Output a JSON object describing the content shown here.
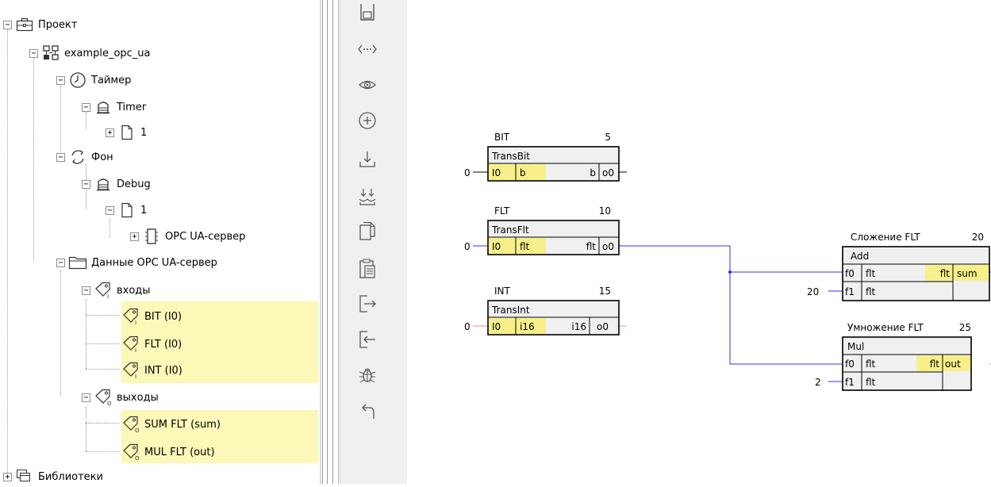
{
  "tree": {
    "items": [
      {
        "label": "Проект",
        "icon": "briefcase-icon"
      },
      {
        "label": "example_opc_ua",
        "icon": "structure-icon"
      },
      {
        "label": "Таймер",
        "icon": "clock-icon"
      },
      {
        "label": "Timer",
        "icon": "task-icon"
      },
      {
        "label": "1",
        "icon": "page-icon"
      },
      {
        "label": "Фон",
        "icon": "cycle-icon"
      },
      {
        "label": "Debug",
        "icon": "task-icon"
      },
      {
        "label": "1",
        "icon": "page-icon"
      },
      {
        "label": "OPC UA-сервер",
        "icon": "chip-icon"
      },
      {
        "label": "Данные OPC UA-сервер",
        "icon": "folder-icon"
      },
      {
        "label": "входы",
        "icon": "tag-icon",
        "sub": "I"
      },
      {
        "label": "BIT  (I0)",
        "icon": "tag-icon",
        "sub": "I"
      },
      {
        "label": "FLT  (I0)",
        "icon": "tag-icon",
        "sub": "I"
      },
      {
        "label": "INT  (I0)",
        "icon": "tag-icon",
        "sub": "I"
      },
      {
        "label": "выходы",
        "icon": "tag-icon",
        "sub": "O"
      },
      {
        "label": "SUM FLT  (sum)",
        "icon": "tag-icon",
        "sub": "O"
      },
      {
        "label": "MUL FLT  (out)",
        "icon": "tag-icon",
        "sub": "O"
      },
      {
        "label": "Библиотеки",
        "icon": "library-icon"
      }
    ]
  },
  "toolbar": {
    "buttons": [
      "save-icon",
      "connect-icon",
      "view-icon",
      "add-icon",
      "download-icon",
      "import-icon",
      "copy-icon",
      "paste-icon",
      "export-icon",
      "login-icon",
      "debug-icon",
      "undo-icon"
    ]
  },
  "blocks": {
    "bit": {
      "name": "BIT",
      "num": "5",
      "type": "TransBit",
      "in": "I0",
      "intype": "b",
      "outtype": "b",
      "out": "o0",
      "const": "0"
    },
    "flt": {
      "name": "FLT",
      "num": "10",
      "type": "TransFlt",
      "in": "I0",
      "intype": "flt",
      "outtype": "flt",
      "out": "o0",
      "const": "0"
    },
    "int": {
      "name": "INT",
      "num": "15",
      "type": "TransInt",
      "in": "I0",
      "intype": "i16",
      "outtype": "i16",
      "out": "o0",
      "const": "0"
    },
    "add": {
      "name": "Сложение FLT",
      "num": "20",
      "type": "Add",
      "in0": "f0",
      "in0type": "flt",
      "in1": "f1",
      "in1type": "flt",
      "outtype": "flt",
      "out": "sum",
      "const1": "20"
    },
    "mul": {
      "name": "Умножение FLT",
      "num": "25",
      "type": "Mul",
      "in0": "f0",
      "in0type": "flt",
      "in1": "f1",
      "in1type": "flt",
      "outtype": "flt",
      "out": "out",
      "const1": "2"
    }
  },
  "colors": {
    "highlight": "#fbf8b8",
    "wire_blue": "#2f2fff",
    "wire_red": "#ff8a8a",
    "block_fill": "#f0f0f0"
  }
}
